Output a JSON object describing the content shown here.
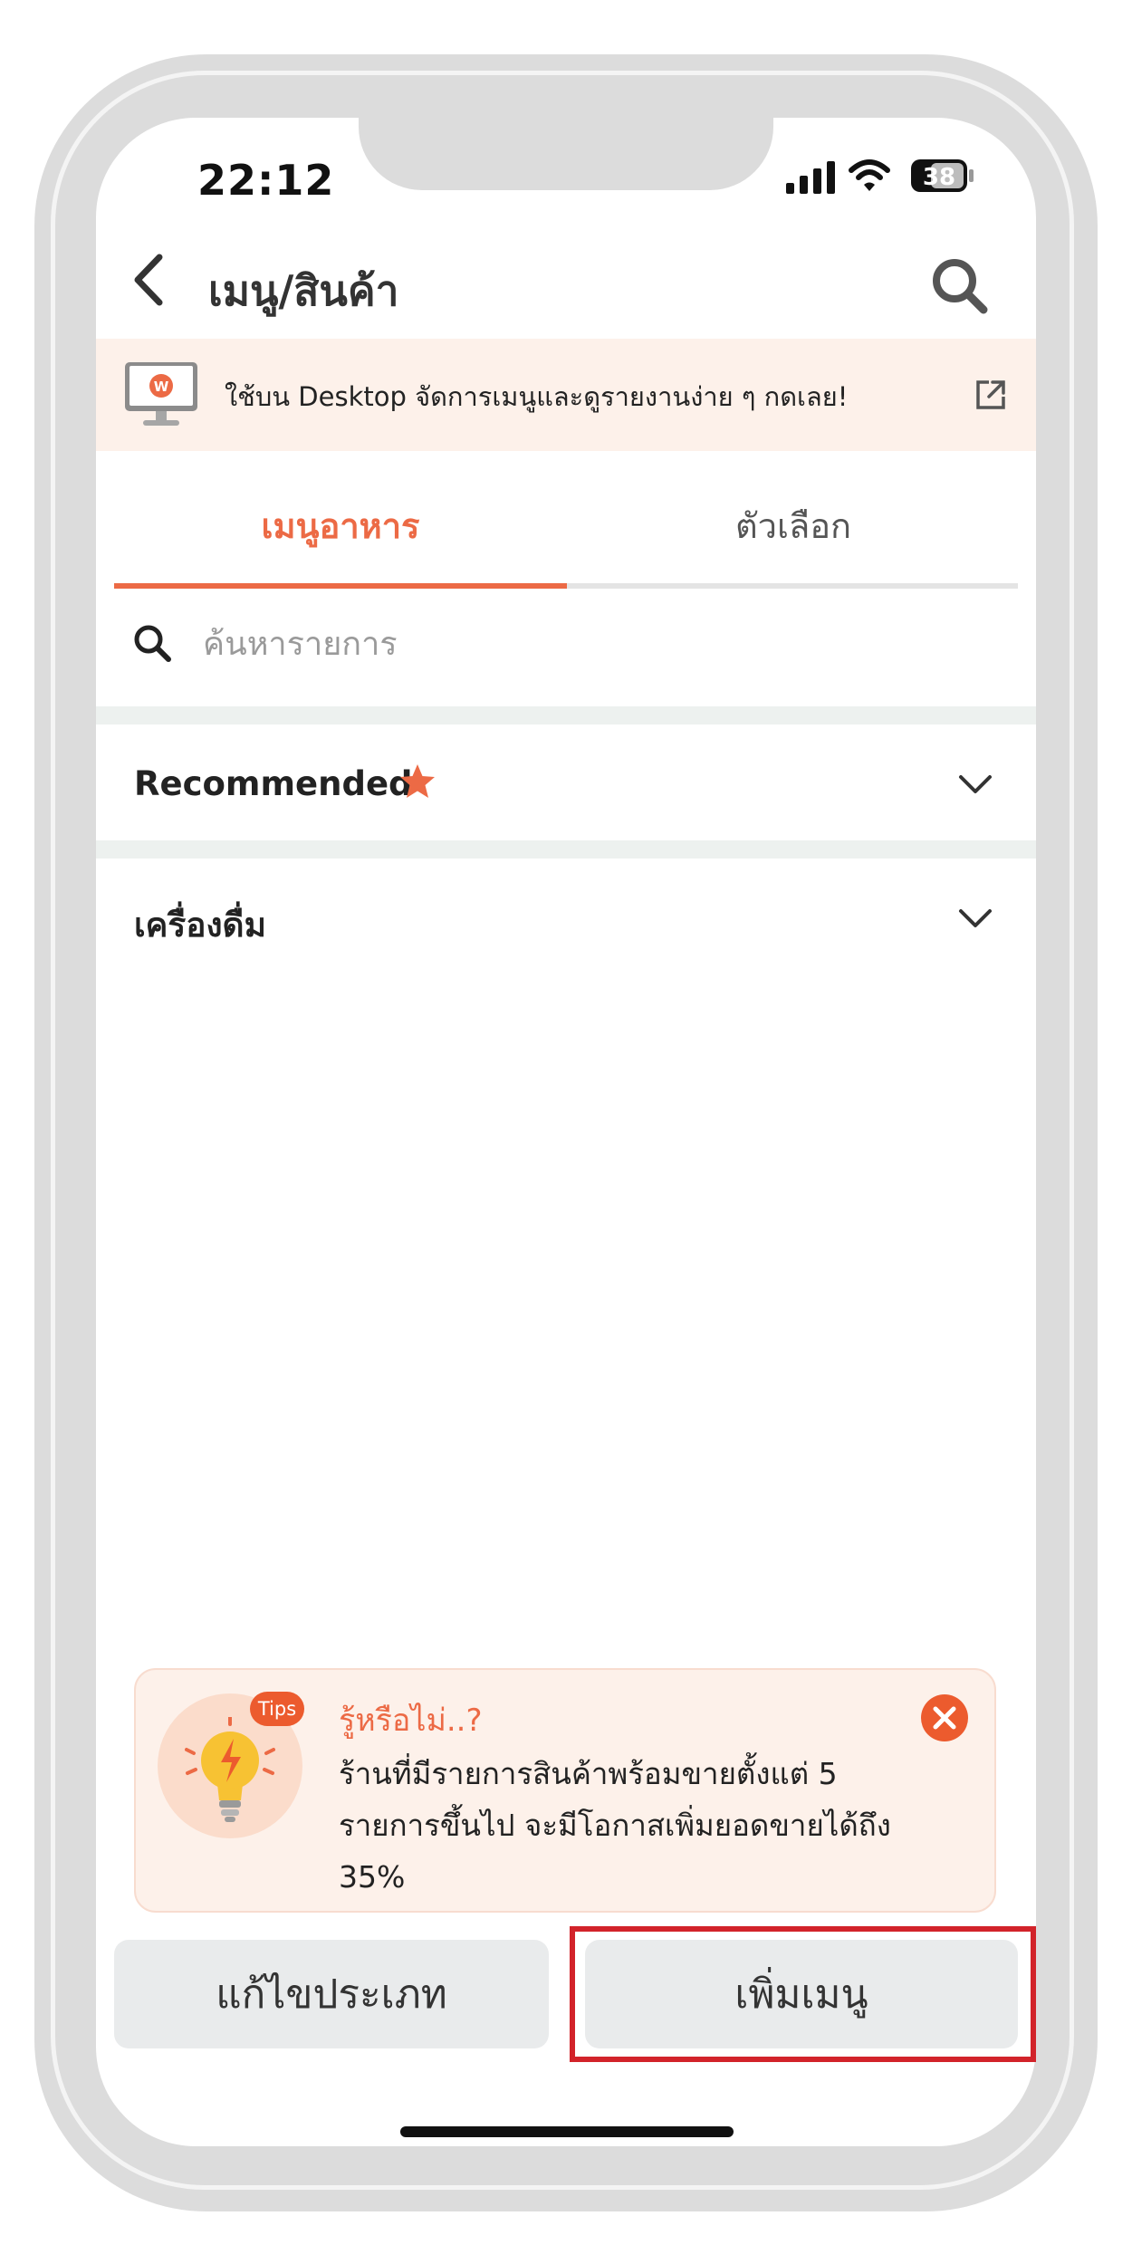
{
  "status_bar": {
    "time": "22:12",
    "battery": "38"
  },
  "header": {
    "title": "เมนู/สินค้า"
  },
  "banner": {
    "text": "ใช้บน Desktop จัดการเมนูและดูรายงานง่าย ๆ กดเลย!",
    "logo_letter": "W"
  },
  "tabs": [
    {
      "label": "เมนูอาหาร",
      "active": true
    },
    {
      "label": "ตัวเลือก",
      "active": false
    }
  ],
  "search": {
    "placeholder": "ค้นหารายการ"
  },
  "categories": [
    {
      "label": "Recommended",
      "starred": true
    },
    {
      "label": "เครื่องดื่ม",
      "starred": false
    }
  ],
  "tips": {
    "badge": "Tips",
    "title": "รู้หรือไม่..?",
    "lines": [
      "ร้านที่มีรายการสินค้าพร้อมขายตั้งแต่ 5",
      "รายการขึ้นไป จะมีโอกาสเพิ่มยอดขายได้ถึง",
      "35%"
    ]
  },
  "buttons": {
    "edit_category": "แก้ไขประเภท",
    "add_menu": "เพิ่มเมนู"
  },
  "colors": {
    "accent": "#ec6a45",
    "highlight": "#d2232a",
    "banner_bg": "#fdf1ea"
  }
}
